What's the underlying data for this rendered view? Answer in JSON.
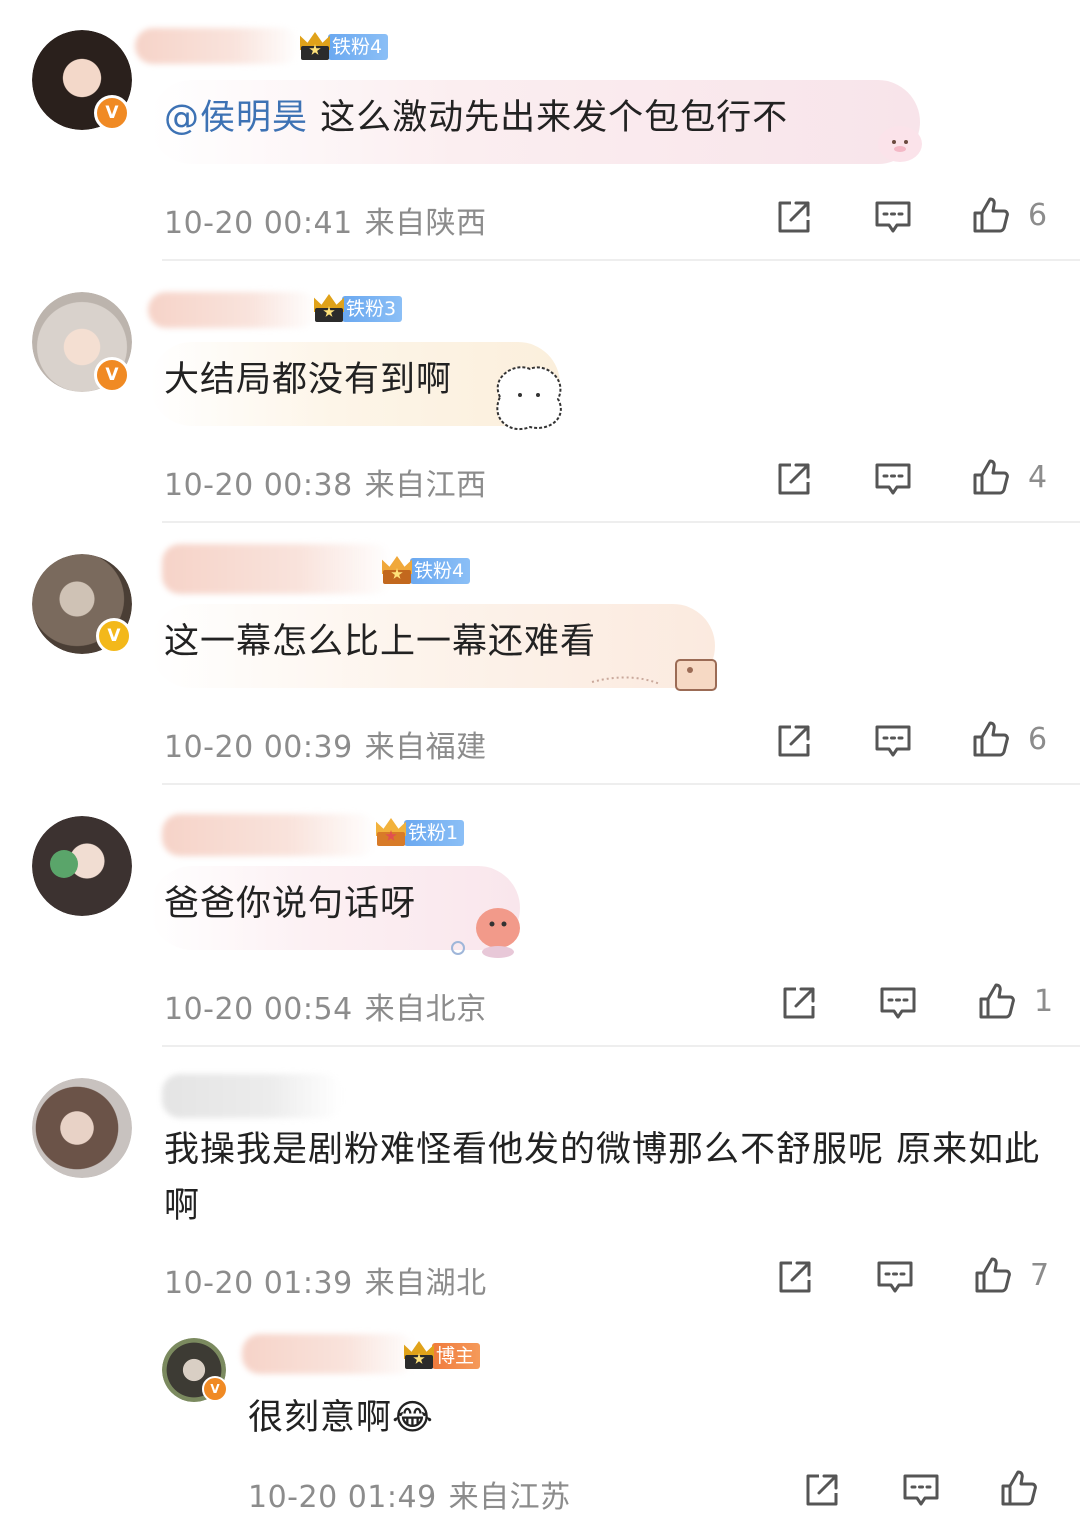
{
  "comments": [
    {
      "fan_badge": "铁粉4",
      "mention": "@侯明昊",
      "text": "这么激动先出来发个包包行不",
      "time": "10-20 00:41",
      "location": "来自陕西",
      "likes": "6"
    },
    {
      "fan_badge": "铁粉3",
      "text": "大结局都没有到啊",
      "time": "10-20 00:38",
      "location": "来自江西",
      "likes": "4"
    },
    {
      "fan_badge": "铁粉4",
      "text": "这一幕怎么比上一幕还难看",
      "time": "10-20 00:39",
      "location": "来自福建",
      "likes": "6"
    },
    {
      "fan_badge": "铁粉1",
      "text": "爸爸你说句话呀",
      "time": "10-20 00:54",
      "location": "来自北京",
      "likes": "1"
    },
    {
      "text": "我操我是剧粉难怪看他发的微博那么不舒服呢 原来如此啊",
      "time": "10-20 01:39",
      "location": "来自湖北",
      "likes": "7"
    }
  ],
  "reply": {
    "badge": "博主",
    "text": "很刻意啊😂",
    "time": "10-20 01:49",
    "location": "来自江苏"
  },
  "icons": {
    "verified": "V",
    "share": "share-icon",
    "comment": "comment-icon",
    "like": "thumbs-up-icon"
  },
  "colors": {
    "mention": "#3d72b4",
    "fan_badge": "#6aa8f0",
    "host_badge": "#f07a3c",
    "verified_orange": "#f08a24",
    "verified_gold": "#f3b81a",
    "meta_text": "#8c8c8c"
  }
}
